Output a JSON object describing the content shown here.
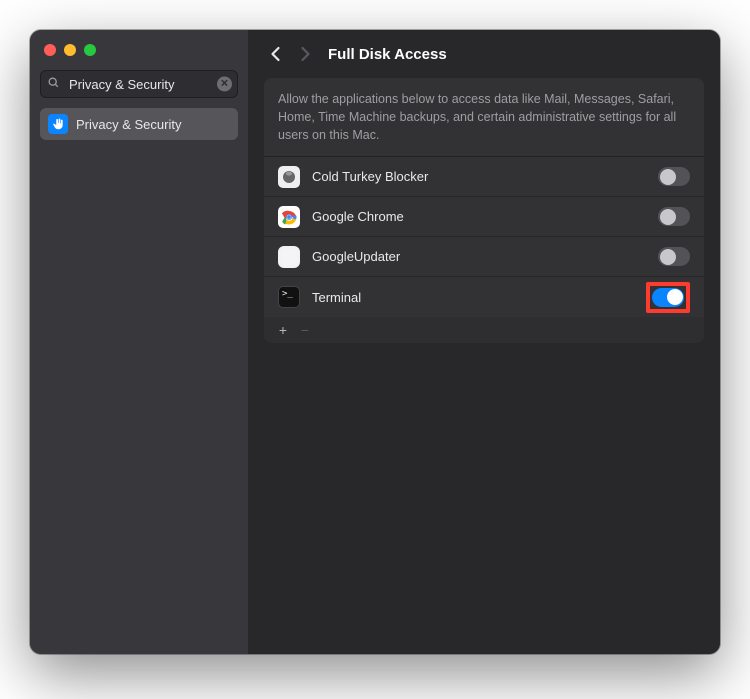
{
  "sidebar": {
    "search_value": "Privacy & Security",
    "items": [
      {
        "label": "Privacy & Security"
      }
    ]
  },
  "header": {
    "title": "Full Disk Access"
  },
  "description": "Allow the applications below to access data like Mail, Messages, Safari, Home, Time Machine backups, and certain administrative settings for all users on this Mac.",
  "apps": [
    {
      "name": "Cold Turkey Blocker",
      "enabled": false,
      "icon": "blocker",
      "highlight": false
    },
    {
      "name": "Google Chrome",
      "enabled": false,
      "icon": "chrome",
      "highlight": false
    },
    {
      "name": "GoogleUpdater",
      "enabled": false,
      "icon": "updater",
      "highlight": false
    },
    {
      "name": "Terminal",
      "enabled": true,
      "icon": "terminal",
      "highlight": true
    }
  ],
  "footer": {
    "add": "+",
    "remove": "−"
  }
}
